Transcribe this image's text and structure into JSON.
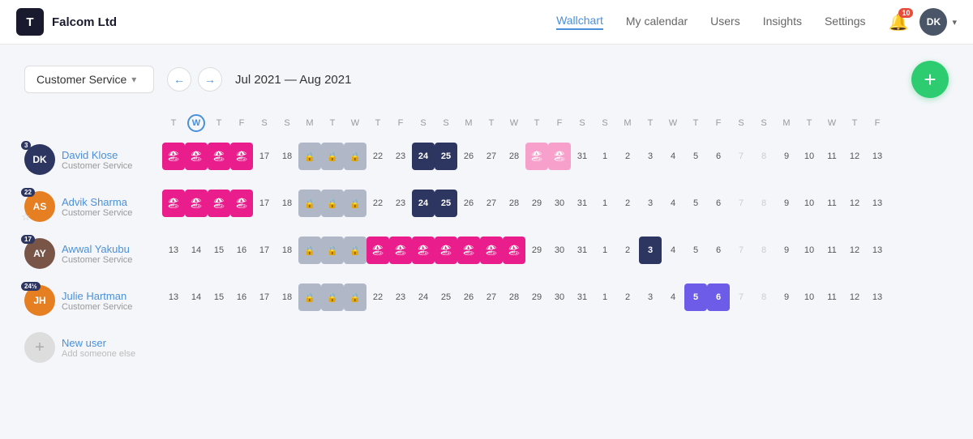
{
  "header": {
    "logo_letter": "T",
    "company": "Falcom Ltd",
    "nav": [
      {
        "label": "Wallchart",
        "active": true
      },
      {
        "label": "My calendar",
        "active": false
      },
      {
        "label": "Users",
        "active": false
      },
      {
        "label": "Insights",
        "active": false
      },
      {
        "label": "Settings",
        "active": false
      }
    ],
    "notif_count": "10",
    "user_initials": "DK"
  },
  "controls": {
    "dept_label": "Customer Service",
    "date_range": "Jul 2021 — Aug 2021",
    "add_label": "+"
  },
  "calendar": {
    "day_headers": [
      {
        "label": "T",
        "today": false
      },
      {
        "label": "W",
        "today": true
      },
      {
        "label": "T",
        "today": false
      },
      {
        "label": "F",
        "today": false
      },
      {
        "label": "S",
        "today": false
      },
      {
        "label": "S",
        "today": false
      },
      {
        "label": "M",
        "today": false
      },
      {
        "label": "T",
        "today": false
      },
      {
        "label": "W",
        "today": false
      },
      {
        "label": "T",
        "today": false
      },
      {
        "label": "F",
        "today": false
      },
      {
        "label": "S",
        "today": false
      },
      {
        "label": "S",
        "today": false
      },
      {
        "label": "M",
        "today": false
      },
      {
        "label": "T",
        "today": false
      },
      {
        "label": "W",
        "today": false
      },
      {
        "label": "T",
        "today": false
      },
      {
        "label": "F",
        "today": false
      },
      {
        "label": "S",
        "today": false
      },
      {
        "label": "S",
        "today": false
      },
      {
        "label": "M",
        "today": false
      },
      {
        "label": "T",
        "today": false
      },
      {
        "label": "W",
        "today": false
      },
      {
        "label": "T",
        "today": false
      },
      {
        "label": "F",
        "today": false
      },
      {
        "label": "S",
        "today": false
      },
      {
        "label": "S",
        "today": false
      },
      {
        "label": "M",
        "today": false
      },
      {
        "label": "T",
        "today": false
      },
      {
        "label": "W",
        "today": false
      },
      {
        "label": "T",
        "today": false
      },
      {
        "label": "F",
        "today": false
      }
    ]
  },
  "employees": [
    {
      "name": "David Klose",
      "dept": "Customer Service",
      "initials": "DK",
      "badge": "3",
      "badge_color": "dark",
      "avatar_color": "#2d3561",
      "has_star": false
    },
    {
      "name": "Advik Sharma",
      "dept": "Customer Service",
      "initials": "AS",
      "badge": "22",
      "badge_color": "dark",
      "avatar_color": "#e67e22",
      "has_star": true
    },
    {
      "name": "Awwal Yakubu",
      "dept": "Customer Service",
      "initials": "AY",
      "badge": "17",
      "badge_color": "dark",
      "avatar_color": "#795548",
      "has_star": false
    },
    {
      "name": "Julie Hartman",
      "dept": "Customer Service",
      "initials": "JH",
      "badge": "24½",
      "badge_color": "dark",
      "avatar_color": "#e67e22",
      "has_star": false
    }
  ],
  "new_user": {
    "name": "New user",
    "sub": "Add someone else"
  }
}
